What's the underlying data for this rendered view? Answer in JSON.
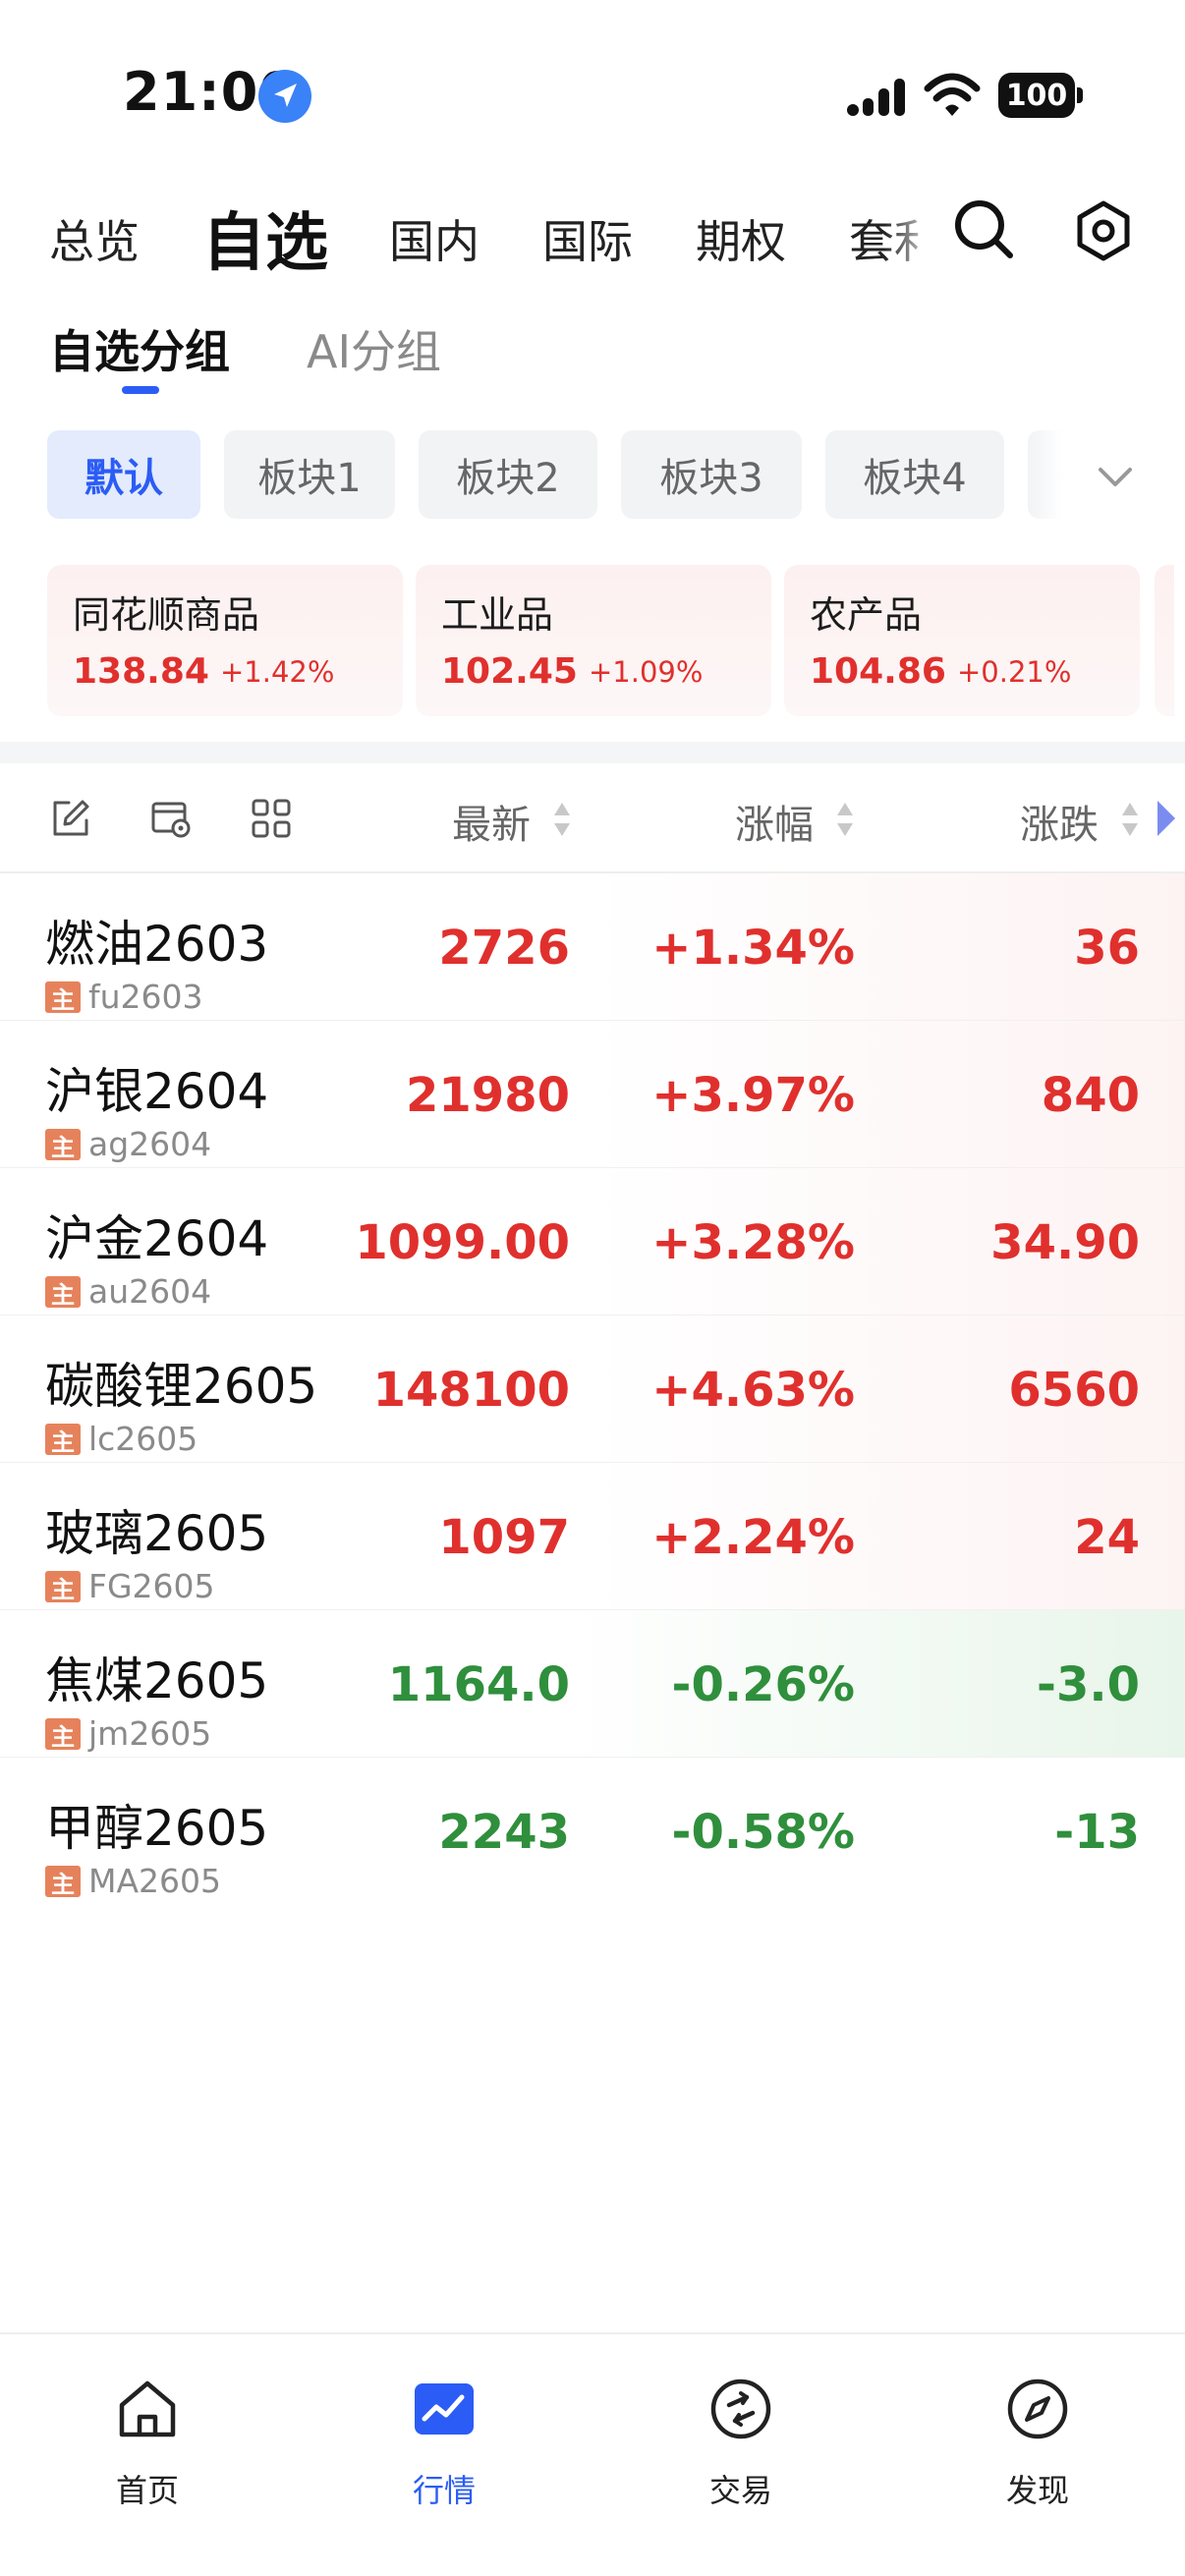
{
  "status": {
    "time": "21:00",
    "battery": "100"
  },
  "top_tabs": [
    "总览",
    "自选",
    "国内",
    "国际",
    "期权",
    "套利"
  ],
  "sub_tabs": [
    "自选分组",
    "AI分组"
  ],
  "groups": [
    "默认",
    "板块1",
    "板块2",
    "板块3",
    "板块4"
  ],
  "index_cards": [
    {
      "name": "同花顺商品",
      "price": "138.84",
      "change": "+1.42%"
    },
    {
      "name": "工业品",
      "price": "102.45",
      "change": "+1.09%"
    },
    {
      "name": "农产品",
      "price": "104.86",
      "change": "+0.21%"
    }
  ],
  "table": {
    "headers": {
      "latest": "最新",
      "pct": "涨幅",
      "diff": "涨跌"
    },
    "rows": [
      {
        "name": "燃油2603",
        "badge": "主",
        "code": "fu2603",
        "latest": "2726",
        "pct": "+1.34%",
        "diff": "36",
        "dir": "up"
      },
      {
        "name": "沪银2604",
        "badge": "主",
        "code": "ag2604",
        "latest": "21980",
        "pct": "+3.97%",
        "diff": "840",
        "dir": "up"
      },
      {
        "name": "沪金2604",
        "badge": "主",
        "code": "au2604",
        "latest": "1099.00",
        "pct": "+3.28%",
        "diff": "34.90",
        "dir": "up"
      },
      {
        "name": "碳酸锂2605",
        "badge": "主",
        "code": "lc2605",
        "latest": "148100",
        "pct": "+4.63%",
        "diff": "6560",
        "dir": "up"
      },
      {
        "name": "玻璃2605",
        "badge": "主",
        "code": "FG2605",
        "latest": "1097",
        "pct": "+2.24%",
        "diff": "24",
        "dir": "up"
      },
      {
        "name": "焦煤2605",
        "badge": "主",
        "code": "jm2605",
        "latest": "1164.0",
        "pct": "-0.26%",
        "diff": "-3.0",
        "dir": "down"
      },
      {
        "name": "甲醇2605",
        "badge": "主",
        "code": "MA2605",
        "latest": "2243",
        "pct": "-0.58%",
        "diff": "-13",
        "dir": "none"
      }
    ]
  },
  "bottom_nav": [
    {
      "label": "首页",
      "icon": "home-icon"
    },
    {
      "label": "行情",
      "icon": "market-chart-icon"
    },
    {
      "label": "交易",
      "icon": "trade-icon"
    },
    {
      "label": "发现",
      "icon": "compass-icon"
    }
  ],
  "colors": {
    "accent": "#2b5cf5",
    "up": "#e0302d",
    "down": "#2f8f3c",
    "badge": "#e6825b"
  }
}
